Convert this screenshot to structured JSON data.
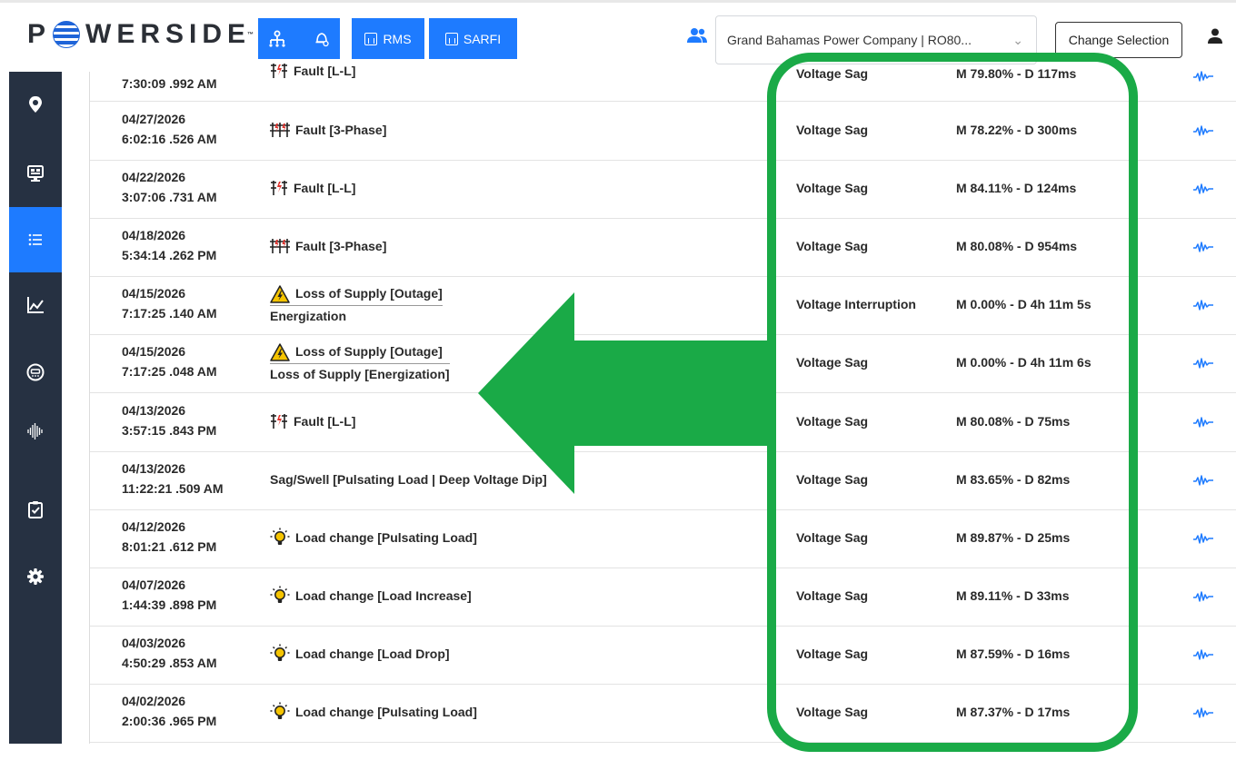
{
  "header": {
    "logo_text": "P",
    "logo_rest": "WERSIDE",
    "logo_tm": "™",
    "buttons": [
      {
        "label": "",
        "icon": "network-icon"
      },
      {
        "label": "",
        "icon": "bell-settings-icon"
      },
      {
        "label": "RMS",
        "icon": "bar-chart-icon"
      },
      {
        "label": "SARFI",
        "icon": "bar-chart-icon"
      }
    ],
    "company_select_value": "Grand Bahamas Power Company | RO80...",
    "change_selection_label": "Change Selection"
  },
  "sidebar": {
    "items": [
      {
        "icon": "map-pin-icon",
        "active": false
      },
      {
        "icon": "monitor-icon",
        "active": false
      },
      {
        "icon": "list-icon",
        "active": true
      },
      {
        "icon": "chart-line-icon",
        "active": false
      },
      {
        "icon": "meter-icon",
        "active": false
      },
      {
        "icon": "waveform-icon",
        "active": false
      },
      {
        "icon": "clipboard-check-icon",
        "active": false
      },
      {
        "icon": "gear-icon",
        "active": false
      }
    ]
  },
  "events": [
    {
      "date": "",
      "time": "7:30:09 .992 AM",
      "icon": "fault-icon",
      "event": "Fault [L-L]",
      "event_line2": "",
      "type": "Voltage Sag",
      "measure": "M 79.80% - D 117ms"
    },
    {
      "date": "04/27/2026",
      "time": "6:02:16 .526 AM",
      "icon": "fault-3phase-icon",
      "event": "Fault [3-Phase]",
      "event_line2": "",
      "type": "Voltage Sag",
      "measure": "M 78.22% - D 300ms"
    },
    {
      "date": "04/22/2026",
      "time": "3:07:06 .731 AM",
      "icon": "fault-icon",
      "event": "Fault [L-L]",
      "event_line2": "",
      "type": "Voltage Sag",
      "measure": "M 84.11% - D 124ms"
    },
    {
      "date": "04/18/2026",
      "time": "5:34:14 .262 PM",
      "icon": "fault-3phase-icon",
      "event": "Fault [3-Phase]",
      "event_line2": "",
      "type": "Voltage Sag",
      "measure": "M 80.08% - D 954ms"
    },
    {
      "date": "04/15/2026",
      "time": "7:17:25 .140 AM",
      "icon": "warning-icon",
      "event": "Loss of Supply [Outage]",
      "event_line2": "Energization",
      "type": "Voltage Interruption",
      "measure": "M 0.00% - D 4h 11m 5s"
    },
    {
      "date": "04/15/2026",
      "time": "7:17:25 .048 AM",
      "icon": "warning-icon",
      "event": "Loss of Supply [Outage]",
      "event_line2": "Loss of Supply [Energization]",
      "type": "Voltage Sag",
      "measure": "M 0.00% - D 4h 11m 6s"
    },
    {
      "date": "04/13/2026",
      "time": "3:57:15 .843 PM",
      "icon": "fault-icon",
      "event": "Fault [L-L]",
      "event_line2": "",
      "type": "Voltage Sag",
      "measure": "M 80.08% - D 75ms"
    },
    {
      "date": "04/13/2026",
      "time": "11:22:21 .509 AM",
      "icon": "",
      "event": "Sag/Swell [Pulsating Load | Deep Voltage Dip]",
      "event_line2": "",
      "type": "Voltage Sag",
      "measure": "M 83.65% - D 82ms"
    },
    {
      "date": "04/12/2026",
      "time": "8:01:21 .612 PM",
      "icon": "lightbulb-icon",
      "event": "Load change [Pulsating Load]",
      "event_line2": "",
      "type": "Voltage Sag",
      "measure": "M 89.87% - D 25ms"
    },
    {
      "date": "04/07/2026",
      "time": "1:44:39 .898 PM",
      "icon": "lightbulb-icon",
      "event": "Load change [Load Increase]",
      "event_line2": "",
      "type": "Voltage Sag",
      "measure": "M 89.11% - D 33ms"
    },
    {
      "date": "04/03/2026",
      "time": "4:50:29 .853 AM",
      "icon": "lightbulb-icon",
      "event": "Load change [Load Drop]",
      "event_line2": "",
      "type": "Voltage Sag",
      "measure": "M 87.59% - D 16ms"
    },
    {
      "date": "04/02/2026",
      "time": "2:00:36 .965 PM",
      "icon": "lightbulb-icon",
      "event": "Load change [Pulsating Load]",
      "event_line2": "",
      "type": "Voltage Sag",
      "measure": "M 87.37% - D 17ms"
    }
  ],
  "colors": {
    "accent_blue": "#1e7bff",
    "sidebar_bg": "#263142",
    "highlight_green": "#1aaa47",
    "fault_red": "#e0302b",
    "warning_yellow": "#f5c400"
  }
}
